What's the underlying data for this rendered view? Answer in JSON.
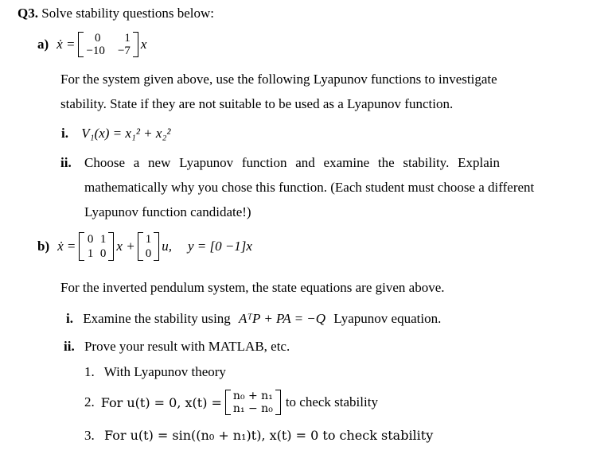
{
  "question": {
    "label": "Q3.",
    "title": "Solve stability questions below:"
  },
  "part_a": {
    "label": "a)",
    "equation_lhs": "ẋ =",
    "matrix": [
      [
        "0",
        "1"
      ],
      [
        "−10",
        "−7"
      ]
    ],
    "equation_rhs": "x",
    "paragraph_line1": "For the system given above, use the following Lyapunov functions to investigate",
    "paragraph_line2": "stability. State if they are not suitable to be used as a Lyapunov function.",
    "items": [
      {
        "label": "i.",
        "text": "V₁(x) = x₁² + x₂²"
      },
      {
        "label": "ii.",
        "line1": "Choose a new Lyapunov function and examine the stability. Explain",
        "line2": "mathematically why you chose this function. (Each student must choose a different",
        "line3": "Lyapunov function candidate!)"
      }
    ]
  },
  "part_b": {
    "label": "b)",
    "equation_lhs": "ẋ =",
    "A": [
      [
        "0",
        "1"
      ],
      [
        "1",
        "0"
      ]
    ],
    "x_plus": "x +",
    "B": [
      [
        "1"
      ],
      [
        "0"
      ]
    ],
    "u_text": "u,",
    "y_eq": "y = [0  −1]x",
    "paragraph": "For the inverted pendulum system, the state equations are given above.",
    "items": [
      {
        "label": "i.",
        "text_before": "Examine the stability using",
        "equation": "AᵀP + PA = −Q",
        "text_after": "Lyapunov equation."
      },
      {
        "label": "ii.",
        "text": "Prove your result with MATLAB, etc."
      }
    ],
    "subitems": [
      {
        "label": "1.",
        "text": "With Lyapunov theory"
      },
      {
        "label": "2.",
        "text_before": "For u(t) = 0,  x(t) =",
        "vector": [
          "n₀ + n₁",
          "n₁ − n₀"
        ],
        "text_after": "to check stability"
      },
      {
        "label": "3.",
        "text": "For u(t) = sin((n₀ + n₁)t),  x(t) = 0 to check stability"
      }
    ]
  }
}
